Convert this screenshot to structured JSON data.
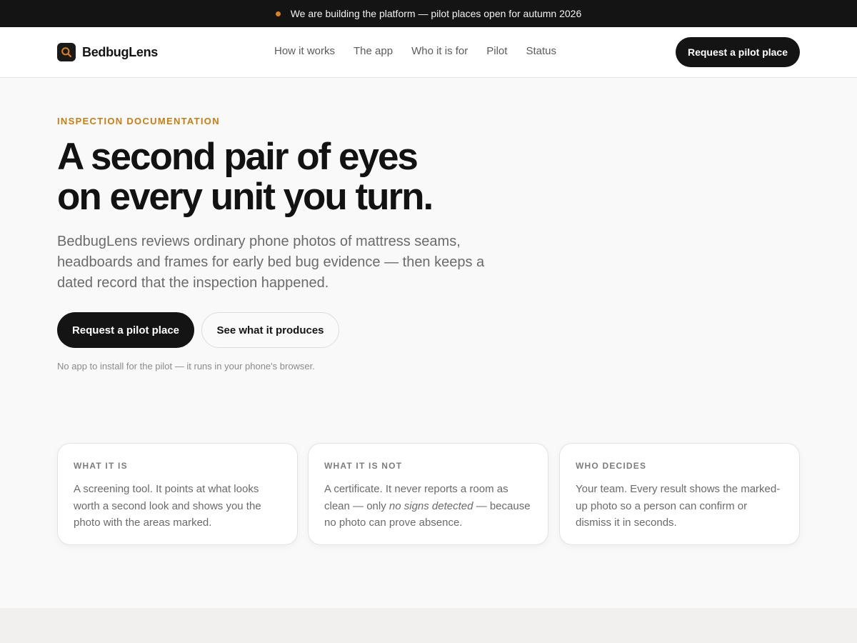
{
  "announcement": {
    "text": "We are building the platform — pilot places open for autumn 2026",
    "dot_color": "#d9831a"
  },
  "header": {
    "logo_icon": "magnifier-icon",
    "logo_text": "BedbugLens",
    "nav": [
      {
        "label": "How it works"
      },
      {
        "label": "The app"
      },
      {
        "label": "Who it is for"
      },
      {
        "label": "Pilot"
      },
      {
        "label": "Status"
      }
    ],
    "cta_label": "Request a pilot place"
  },
  "hero": {
    "eyebrow": "INSPECTION DOCUMENTATION",
    "headline_line1": "A second pair of eyes",
    "headline_line2": "on every unit you turn.",
    "lede": "BedbugLens reviews ordinary phone photos of mattress seams, headboards and frames for early bed bug evidence — then keeps a dated record that the inspection happened.",
    "primary_button": "Request a pilot place",
    "secondary_button": "See what it produces",
    "note": "No app to install for the pilot — it runs in your phone's browser."
  },
  "cards": [
    {
      "label": "WHAT IT IS",
      "body": "A screening tool. It points at what looks worth a second look and shows you the photo with the areas marked."
    },
    {
      "label": "WHAT IT IS NOT",
      "body_before": "A certificate. It never reports a room as clean — only ",
      "body_emphasis": "no signs detected",
      "body_after": " — because no photo can prove absence."
    },
    {
      "label": "WHO DECIDES",
      "body": "Your team. Every result shows the marked-up photo so a person can confirm or dismiss it in seconds."
    }
  ],
  "colors": {
    "accent": "#c77d12",
    "dark": "#141414",
    "background": "#f9f9f9"
  }
}
